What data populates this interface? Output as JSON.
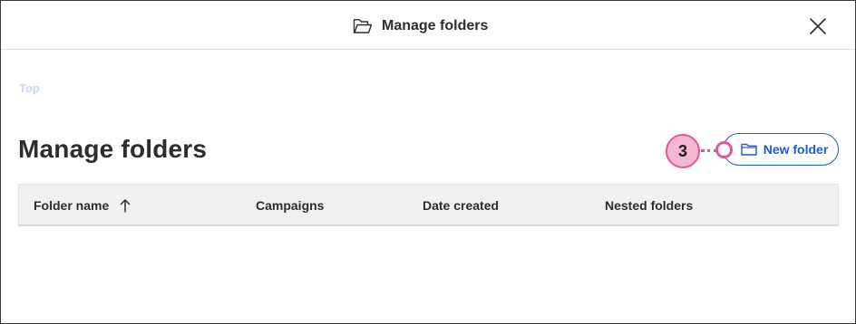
{
  "modal": {
    "title": "Manage folders",
    "title_icon": "folder-open-icon",
    "close_icon": "close-icon"
  },
  "breadcrumb": {
    "items": [
      "Top"
    ]
  },
  "page": {
    "title": "Manage folders"
  },
  "callout": {
    "number": "3",
    "color": "#e0589a"
  },
  "toolbar": {
    "new_folder_label": "New folder",
    "new_folder_icon": "folder-icon",
    "accent_color": "#1f5bd6"
  },
  "table": {
    "columns": [
      {
        "label": "Folder name",
        "sort": "ascending",
        "sort_icon": "arrow-up-icon"
      },
      {
        "label": "Campaigns"
      },
      {
        "label": "Date created"
      },
      {
        "label": "Nested folders"
      }
    ],
    "rows": []
  }
}
